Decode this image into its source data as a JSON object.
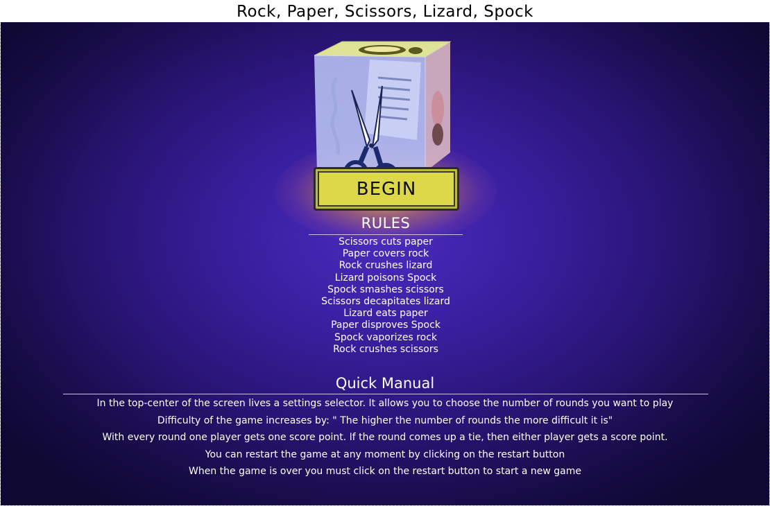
{
  "title": "Rock, Paper, Scissors, Lizard, Spock",
  "cube": {
    "front_icon": "scissors-icon",
    "top_icon": "spock-hand-icon",
    "side_icon": "rock-icon",
    "back_icon": "paper-icon",
    "left_icon": "lizard-icon"
  },
  "begin_button": {
    "label": "BEGIN"
  },
  "rules": {
    "heading": "RULES",
    "items": [
      "Scissors cuts paper",
      "Paper covers rock",
      "Rock crushes lizard",
      "Lizard poisons Spock",
      "Spock smashes scissors",
      "Scissors decapitates lizard",
      "Lizard eats paper",
      "Paper disproves Spock",
      "Spock vaporizes rock",
      "Rock crushes scissors"
    ]
  },
  "manual": {
    "heading": "Quick Manual",
    "items": [
      "In the top-center of the screen lives a settings selector. It allows you to choose the number of rounds you want to play",
      "Difficulty of the game increases by: \" The higher the number of rounds the more difficult it is\"",
      "With every round one player gets one score point. If the round comes up a tie, then either player gets a score point.",
      "You can restart the game at any moment by clicking on the restart button",
      "When the game is over you must click on the restart button to start a new game"
    ]
  },
  "colors": {
    "background": "#2a1577",
    "button": "#dcd84a",
    "text": "#ffffff"
  }
}
